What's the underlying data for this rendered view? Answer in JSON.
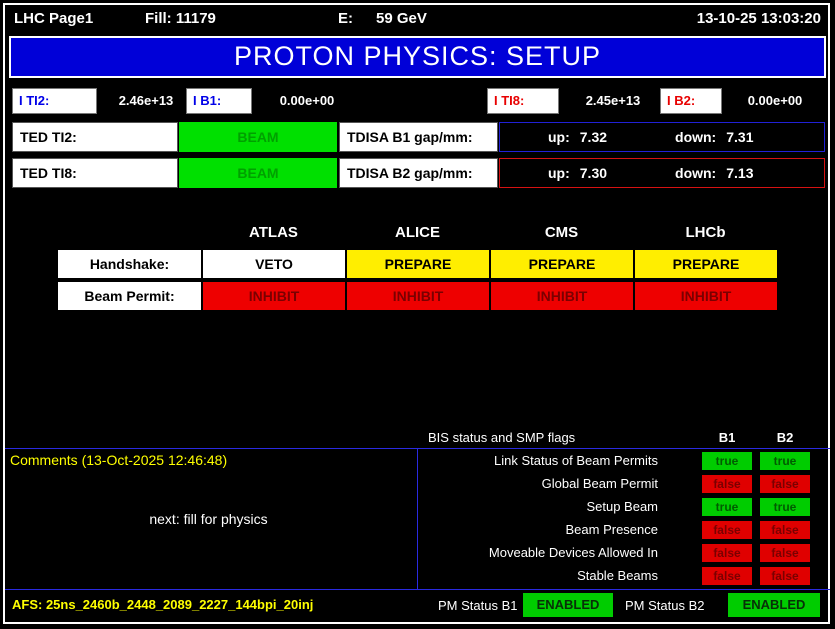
{
  "colors": {
    "banner_blue": "#0000d8",
    "green": "#00cc00",
    "red": "#e00000",
    "yellow": "#ffee00",
    "line_blue": "#2a2ae0"
  },
  "topbar": {
    "page": "LHC Page1",
    "fill": "Fill: 11179",
    "energy_label": "E:",
    "energy_value": "59 GeV",
    "datetime": "13-10-25 13:03:20"
  },
  "banner": {
    "title": "PROTON PHYSICS: SETUP"
  },
  "intensities": [
    {
      "label": "I TI2:",
      "value": "2.46e+13"
    },
    {
      "label": "I B1:",
      "value": "0.00e+00"
    },
    {
      "label": "I TI8:",
      "value": "2.45e+13"
    },
    {
      "label": "I B2:",
      "value": "0.00e+00"
    }
  ],
  "ted": [
    {
      "label": "TED TI2:",
      "status": "BEAM",
      "gap_label": "TDISA B1 gap/mm:",
      "up_label": "up:",
      "up_value": "7.32",
      "down_label": "down:",
      "down_value": "7.31"
    },
    {
      "label": "TED TI8:",
      "status": "BEAM",
      "gap_label": "TDISA B2 gap/mm:",
      "up_label": "up:",
      "up_value": "7.30",
      "down_label": "down:",
      "down_value": "7.13"
    }
  ],
  "experiments": {
    "columns": [
      "ATLAS",
      "ALICE",
      "CMS",
      "LHCb"
    ],
    "handshake_label": "Handshake:",
    "handshake": [
      "VETO",
      "PREPARE",
      "PREPARE",
      "PREPARE"
    ],
    "beam_permit_label": "Beam Permit:",
    "beam_permit": [
      "INHIBIT",
      "INHIBIT",
      "INHIBIT",
      "INHIBIT"
    ]
  },
  "comments": {
    "title": "Comments (13-Oct-2025 12:46:48)",
    "text": "next: fill for physics"
  },
  "bis": {
    "title": "BIS status and SMP flags",
    "b1_header": "B1",
    "b2_header": "B2",
    "rows": [
      {
        "label": "Link Status of Beam Permits",
        "b1": "true",
        "b2": "true"
      },
      {
        "label": "Global Beam Permit",
        "b1": "false",
        "b2": "false"
      },
      {
        "label": "Setup Beam",
        "b1": "true",
        "b2": "true"
      },
      {
        "label": "Beam Presence",
        "b1": "false",
        "b2": "false"
      },
      {
        "label": "Moveable Devices Allowed In",
        "b1": "false",
        "b2": "false"
      },
      {
        "label": "Stable Beams",
        "b1": "false",
        "b2": "false"
      }
    ]
  },
  "footer": {
    "afs": "AFS: 25ns_2460b_2448_2089_2227_144bpi_20inj",
    "pm_b1_label": "PM Status B1",
    "pm_b1_value": "ENABLED",
    "pm_b2_label": "PM Status B2",
    "pm_b2_value": "ENABLED"
  }
}
